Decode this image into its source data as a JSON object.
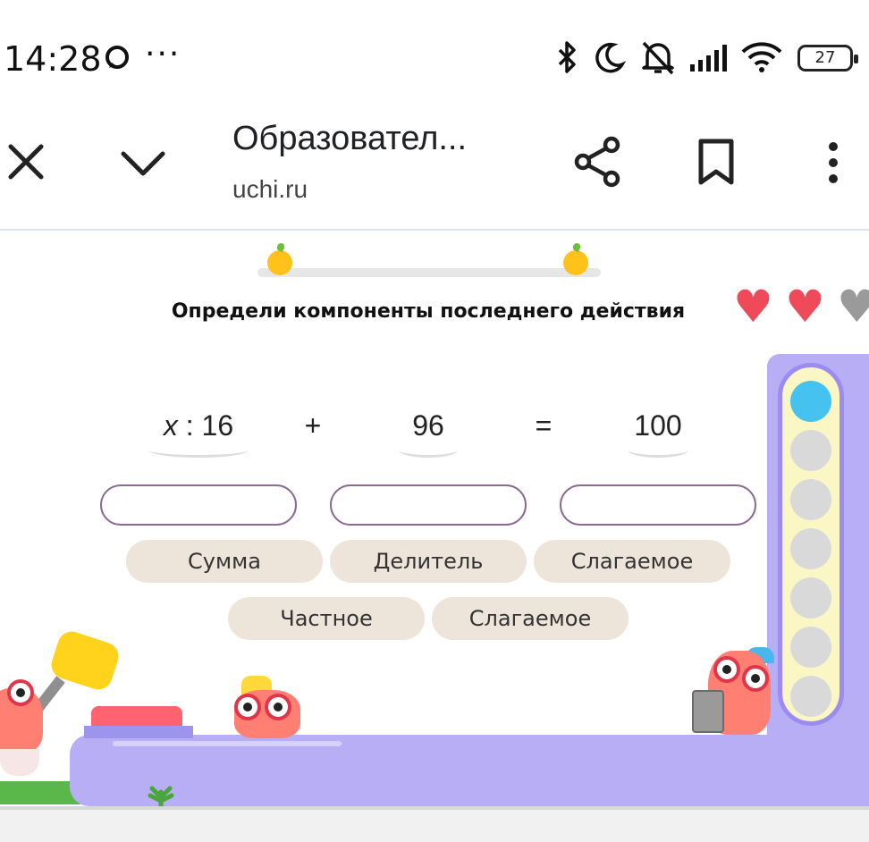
{
  "status_bar": {
    "time": "14:28",
    "more": "···",
    "battery": "27",
    "icons": [
      "chat-bubble-icon",
      "bluetooth-icon",
      "moon-icon",
      "bell-muted-icon",
      "signal-icon",
      "wifi-icon",
      "battery-icon"
    ]
  },
  "browser": {
    "title": "Образовател...",
    "url": "uchi.ru",
    "icons": [
      "close-icon",
      "chevron-down-icon",
      "share-icon",
      "bookmark-icon",
      "more-vert-icon"
    ]
  },
  "task": {
    "instruction": "Определи компоненты последнего действия",
    "lives": [
      {
        "state": "full",
        "color": "#ee4a5a"
      },
      {
        "state": "full",
        "color": "#ee4a5a"
      },
      {
        "state": "lost",
        "color": "#9a9a9a"
      }
    ],
    "expression": {
      "term1_var": "x",
      "term1_rest": " : 16",
      "op1": "+",
      "term2": "96",
      "eq": "=",
      "result": "100"
    },
    "answer_slots": [
      "",
      "",
      ""
    ],
    "choices_row1": [
      "Сумма",
      "Делитель",
      "Слагаемое"
    ],
    "choices_row2": [
      "Частное",
      "Слагаемое"
    ]
  },
  "progress": {
    "completed": 1,
    "total": 7,
    "active_color": "#45c2ef"
  },
  "colors": {
    "answer_border": "#8a6a90",
    "chip_bg": "#ede4da",
    "floor": "#b7aef6",
    "heart": "#ee4a5a"
  }
}
